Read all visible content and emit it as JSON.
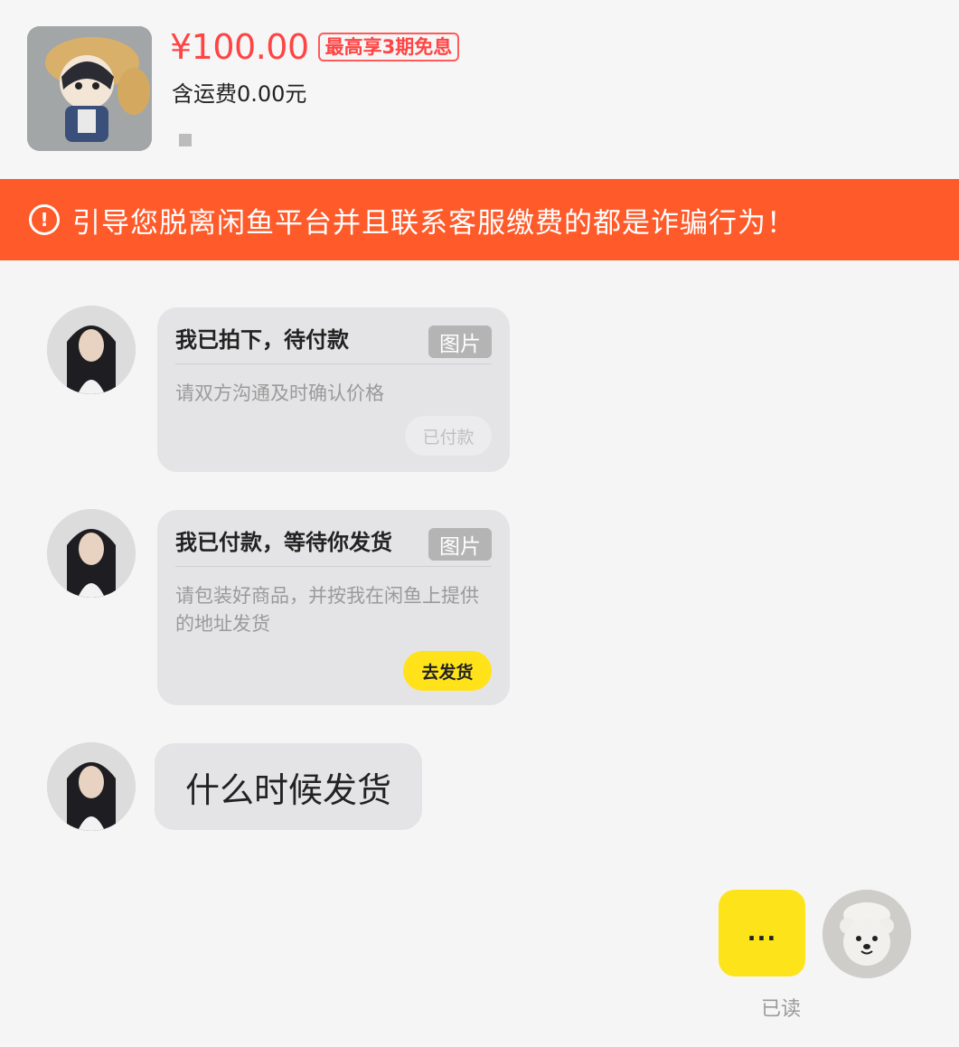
{
  "product": {
    "price": "¥100.00",
    "installment_badge": "最高享3期免息",
    "shipping": "含运费0.00元",
    "thumbnail_icon": "plush-keychain-photo"
  },
  "warning_banner": {
    "icon": "exclamation-circle-icon",
    "text": "引导您脱离闲鱼平台并且联系客服缴费的都是诈骗行为！",
    "color": "#ff5a2a"
  },
  "messages": [
    {
      "sender": "buyer",
      "type": "card",
      "title": "我已拍下，待付款",
      "tag": "图片",
      "description": "请双方沟通及时确认价格",
      "button": "已付款",
      "button_state": "disabled"
    },
    {
      "sender": "buyer",
      "type": "card",
      "title": "我已付款，等待你发货",
      "tag": "图片",
      "description": "请包装好商品，并按我在闲鱼上提供的地址发货",
      "button": "去发货",
      "button_state": "active"
    },
    {
      "sender": "buyer",
      "type": "text",
      "text": "什么时候发货"
    },
    {
      "sender": "me",
      "type": "text",
      "text": "...",
      "status": "已读"
    }
  ],
  "colors": {
    "accent_yellow": "#fde41a",
    "price_red": "#ff4444"
  }
}
